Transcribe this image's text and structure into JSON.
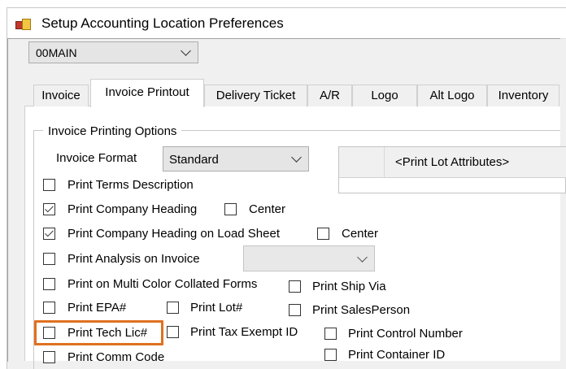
{
  "window": {
    "title": "Setup Accounting Location Preferences"
  },
  "location": {
    "selected": "00MAIN"
  },
  "tabs": [
    {
      "label": "Invoice",
      "active": false
    },
    {
      "label": "Invoice Printout",
      "active": true
    },
    {
      "label": "Delivery Ticket",
      "active": false
    },
    {
      "label": "A/R",
      "active": false
    },
    {
      "label": "Logo",
      "active": false
    },
    {
      "label": "Alt Logo",
      "active": false
    },
    {
      "label": "Inventory",
      "active": false
    }
  ],
  "group": {
    "title": "Invoice Printing Options"
  },
  "invoice_format": {
    "label": "Invoice Format",
    "value": "Standard"
  },
  "lot_attributes": {
    "header": "<Print Lot Attributes>"
  },
  "checkboxes": {
    "terms": {
      "label": "Print Terms Description",
      "checked": false
    },
    "company_heading": {
      "label": "Print Company Heading",
      "checked": true
    },
    "company_heading_center": {
      "label": "Center",
      "checked": false
    },
    "heading_load_sheet": {
      "label": "Print Company Heading on Load Sheet",
      "checked": true
    },
    "heading_load_sheet_center": {
      "label": "Center",
      "checked": false
    },
    "analysis": {
      "label": "Print Analysis on Invoice",
      "checked": false
    },
    "multi_color": {
      "label": "Print on Multi Color Collated Forms",
      "checked": false
    },
    "ship_via": {
      "label": "Print Ship Via",
      "checked": false
    },
    "epa": {
      "label": "Print EPA#",
      "checked": false
    },
    "lot": {
      "label": "Print Lot#",
      "checked": false
    },
    "salesperson": {
      "label": "Print SalesPerson",
      "checked": false
    },
    "tech_lic": {
      "label": "Print Tech Lic#",
      "checked": false
    },
    "tax_exempt": {
      "label": "Print Tax Exempt ID",
      "checked": false
    },
    "control_number": {
      "label": "Print Control Number",
      "checked": false
    },
    "comm_code": {
      "label": "Print Comm Code",
      "checked": false
    },
    "container_id": {
      "label": "Print Container ID",
      "checked": false
    }
  },
  "colors": {
    "highlight": "#e07020",
    "window_bg": "#f0f0f0"
  }
}
